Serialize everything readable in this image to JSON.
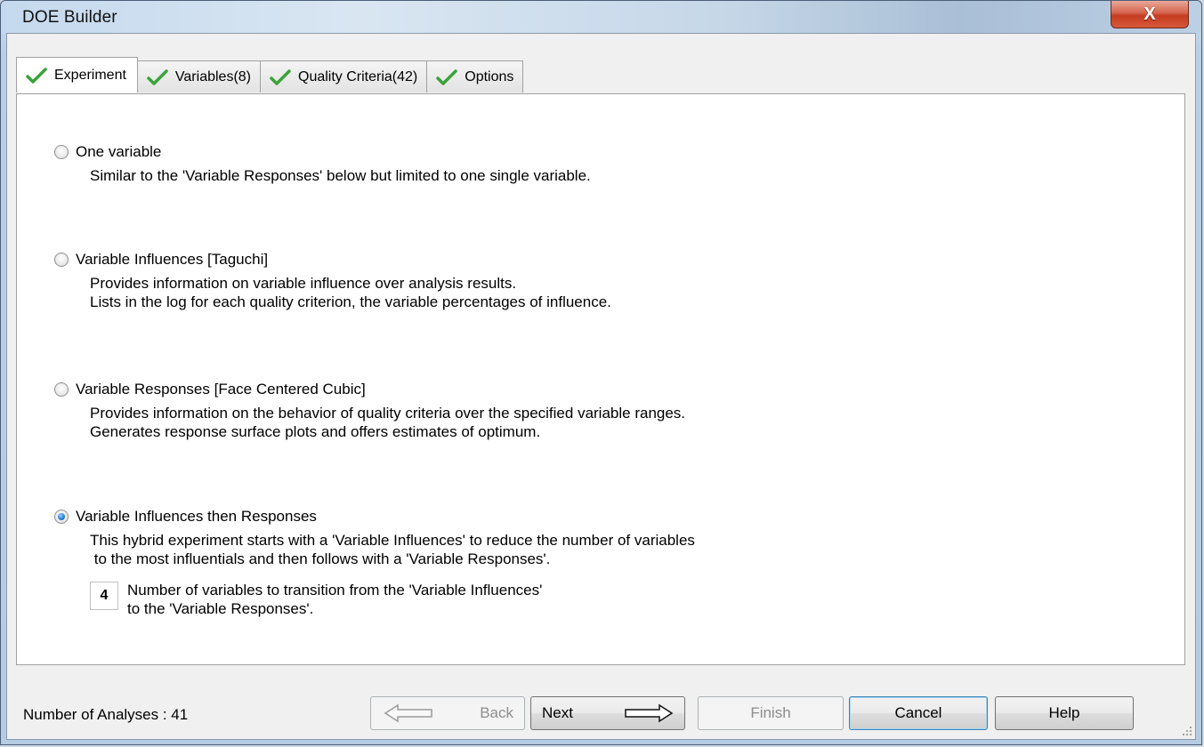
{
  "window": {
    "title": "DOE Builder",
    "close_glyph": "X"
  },
  "tabs": [
    {
      "label": "Experiment",
      "icon": "check-icon",
      "active": true
    },
    {
      "label": "Variables(8)",
      "icon": "check-icon",
      "active": false
    },
    {
      "label": "Quality Criteria(42)",
      "icon": "check-icon",
      "active": false
    },
    {
      "label": "Options",
      "icon": "check-icon",
      "active": false
    }
  ],
  "options": [
    {
      "label": "One variable",
      "selected": false,
      "description": "Similar to the 'Variable Responses' below but limited to one single variable."
    },
    {
      "label": "Variable Influences [Taguchi]",
      "selected": false,
      "description": "Provides information on variable influence over analysis results.\nLists in the log for each quality criterion, the variable percentages of influence."
    },
    {
      "label": "Variable Responses [Face Centered Cubic]",
      "selected": false,
      "description": "Provides information on the behavior of quality criteria over the specified variable ranges.\nGenerates response surface plots and offers estimates of optimum."
    },
    {
      "label": "Variable Influences then Responses",
      "selected": true,
      "description": "This hybrid experiment starts with a 'Variable Influences' to reduce the number of variables\n to the most influentials and then follows with a 'Variable Responses'."
    }
  ],
  "transition": {
    "value": "4",
    "text": "Number of variables to transition from the 'Variable Influences'\nto the 'Variable Responses'."
  },
  "footer": {
    "status": "Number of Analyses : 41",
    "back_label": "Back",
    "next_label": "Next",
    "finish_label": "Finish",
    "cancel_label": "Cancel",
    "help_label": "Help"
  },
  "colors": {
    "check": "#3aa33a",
    "selected_radio": "#2a7fd6",
    "close": "#c53b20"
  }
}
